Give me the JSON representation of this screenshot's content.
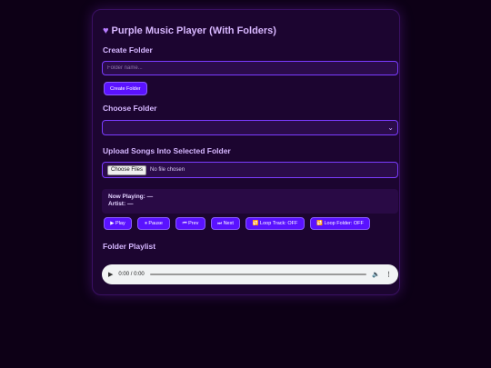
{
  "app": {
    "title": "Purple Music Player (With Folders)",
    "title_icon": "purple-heart-icon"
  },
  "create_folder": {
    "heading": "Create Folder",
    "input_placeholder": "Folder name...",
    "input_value": "",
    "button_label": "Create Folder"
  },
  "choose_folder": {
    "heading": "Choose Folder",
    "selected_value": ""
  },
  "upload": {
    "heading": "Upload Songs Into Selected Folder",
    "button_label": "Choose Files",
    "status": "No file chosen"
  },
  "now_playing": {
    "line1": "Now Playing: —",
    "line2": "Artist: —"
  },
  "controls": {
    "play": "▶ Play",
    "pause": "⏸ Pause",
    "prev": "⏮ Prev",
    "next": "⏭ Next",
    "loop_track": "🔁 Loop Track: OFF",
    "loop_folder": "🔁 Loop Folder: OFF"
  },
  "playlist": {
    "heading": "Folder Playlist"
  },
  "audio_player": {
    "time": "0:00 / 0:00",
    "progress": 0
  },
  "colors": {
    "accent": "#5a12ff",
    "background": "#0d0016",
    "panel": "#1c0530",
    "heading": "#d5b6ff"
  }
}
